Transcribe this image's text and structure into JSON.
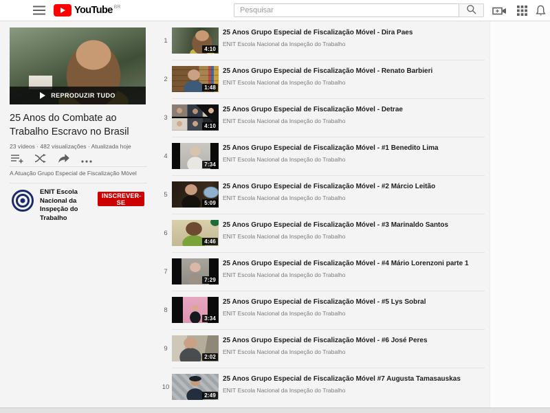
{
  "header": {
    "brand": "YouTube",
    "brand_badge": "BR",
    "search_placeholder": "Pesquisar"
  },
  "icons": {
    "menu": "hamburger",
    "search": "magnifier",
    "create_video": "camcorder-plus",
    "apps": "grid-3x3",
    "notifications": "bell",
    "play_all": "play-triangle",
    "save_playlist": "playlist-add",
    "shuffle": "crossed-arrows",
    "share": "share-arrow",
    "more": "ellipsis",
    "channel_logo": "concentric-circles"
  },
  "playlist": {
    "play_all_label": "REPRODUZIR TUDO",
    "title": "25 Anos do Combate ao Trabalho Escravo no Brasil",
    "stats": "23 vídeos · 482 visualizações · Atualizada hoje",
    "description": "A Atuação Grupo Especial de Fiscalização Móvel",
    "channel_name": "ENIT Escola Nacional da Inspeção do Trabalho",
    "subscribe_label": "INSCREVER-SE",
    "subscribe_color": "#cc0000",
    "logo_color": "#1c2b66"
  },
  "videos": [
    {
      "index": "1",
      "title": "25 Anos Grupo Especial de Fiscalização Móvel - Dira Paes",
      "channel": "ENIT Escola Nacional da Inspeção do Trabalho",
      "duration": "4:10"
    },
    {
      "index": "2",
      "title": "25 Anos Grupo Especial de Fiscalização Móvel - Renato Barbieri",
      "channel": "ENIT Escola Nacional da Inspeção do Trabalho",
      "duration": "1:48"
    },
    {
      "index": "3",
      "title": "25 Anos Grupo Especial de Fiscalização Móvel - Detrae",
      "channel": "ENIT Escola Nacional da Inspeção do Trabalho",
      "duration": "4:10"
    },
    {
      "index": "4",
      "title": "25 Anos Grupo Especial de Fiscalização Móvel - #1 Benedito Lima",
      "channel": "ENIT Escola Nacional da Inspeção do Trabalho",
      "duration": "7:34"
    },
    {
      "index": "5",
      "title": "25 Anos Grupo Especial de Fiscalização Móvel - #2 Márcio Leitão",
      "channel": "ENIT Escola Nacional da Inspeção do Trabalho",
      "duration": "5:09"
    },
    {
      "index": "6",
      "title": "25 Anos Grupo Especial de Fiscalização Móvel - #3 Marinaldo Santos",
      "channel": "ENIT Escola Nacional da Inspeção do Trabalho",
      "duration": "4:46"
    },
    {
      "index": "7",
      "title": "25 Anos Grupo Especial de Fiscalização Móvel - #4 Mário Lorenzoni parte 1",
      "channel": "ENIT Escola Nacional da Inspeção do Trabalho",
      "duration": "7:29"
    },
    {
      "index": "8",
      "title": "25 Anos Grupo Especial de Fiscalização Móvel - #5 Lys Sobral",
      "channel": "ENIT Escola Nacional da Inspeção do Trabalho",
      "duration": "3:34"
    },
    {
      "index": "9",
      "title": "25 Anos Grupo Especial de Fiscalização Móvel - #6 José Peres",
      "channel": "ENIT Escola Nacional da Inspeção do Trabalho",
      "duration": "2:02"
    },
    {
      "index": "10",
      "title": "25 Anos Grupo Especial de Fiscalização Móvel #7 Augusta Tamasauskas",
      "channel": "ENIT Escola Nacional da Inspeção do Trabalho",
      "duration": "2:49"
    }
  ]
}
